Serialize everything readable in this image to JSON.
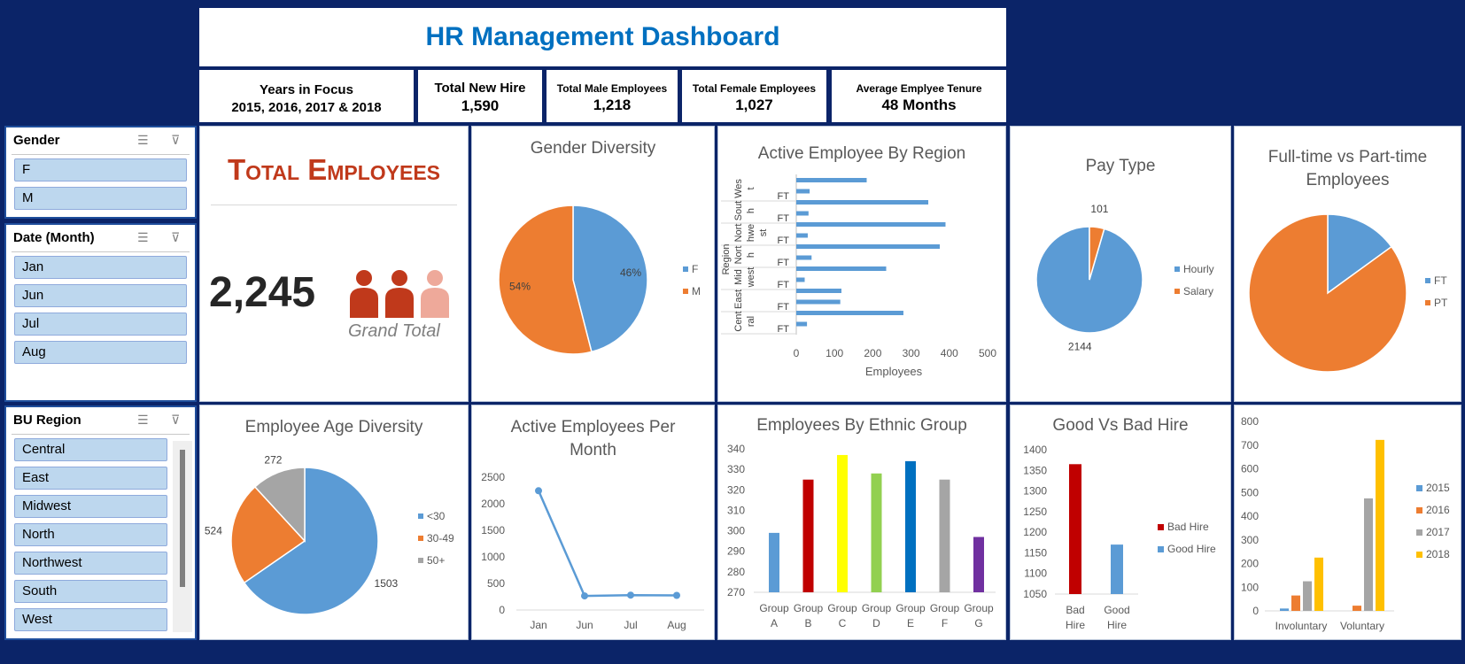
{
  "header": {
    "title": "HR Management Dashboard"
  },
  "kpis": {
    "years": {
      "label": "Years in Focus",
      "value": "2015, 2016, 2017 & 2018"
    },
    "new_hire": {
      "label": "Total New Hire",
      "value": "1,590"
    },
    "male": {
      "label": "Total Male Employees",
      "value": "1,218"
    },
    "female": {
      "label": "Total Female Employees",
      "value": "1,027"
    },
    "tenure": {
      "label": "Average Emplyee Tenure",
      "value": "48 Months"
    }
  },
  "slicers": {
    "gender": {
      "title": "Gender",
      "items": [
        "F",
        "M"
      ]
    },
    "month": {
      "title": "Date (Month)",
      "items": [
        "Jan",
        "Jun",
        "Jul",
        "Aug"
      ]
    },
    "region": {
      "title": "BU Region",
      "items": [
        "Central",
        "East",
        "Midwest",
        "North",
        "Northwest",
        "South",
        "West"
      ]
    }
  },
  "total_employees": {
    "title": "Total Employees",
    "value": "2,245",
    "caption": "Grand Total"
  },
  "colors": {
    "blue": "#5b9bd5",
    "orange": "#ed7d31",
    "gray": "#a5a5a5",
    "yellow": "#ffc000",
    "navy": "#0b2468",
    "title_blue": "#0070c0",
    "red": "#c0391b"
  },
  "chart_data": [
    {
      "id": "gender",
      "type": "pie",
      "title": "Gender Diversity",
      "labels": [
        "F",
        "M"
      ],
      "values": [
        46,
        54
      ],
      "data_labels": [
        "46%",
        "54%"
      ],
      "colors": [
        "#5b9bd5",
        "#ed7d31"
      ],
      "legend": "right"
    },
    {
      "id": "region",
      "type": "bar",
      "orientation": "horizontal",
      "title": "Active Employee By Region",
      "xlabel": "Employees",
      "ylabel": "Region",
      "xlim": [
        0,
        500
      ],
      "xticks": [
        0,
        100,
        200,
        300,
        400,
        500
      ],
      "groups": [
        "Wes t",
        "Sout h",
        "Nort hwe st",
        "Nort h",
        "Mid west",
        "East",
        "Cent ral"
      ],
      "sub_label": "FT",
      "values": [
        184,
        35,
        345,
        32,
        390,
        30,
        375,
        40,
        235,
        22,
        118,
        115,
        280,
        28
      ],
      "color": "#5b9bd5",
      "grid": false
    },
    {
      "id": "paytype",
      "type": "pie",
      "title": "Pay Type",
      "labels": [
        "Hourly",
        "Salary"
      ],
      "values": [
        2144,
        101
      ],
      "data_labels": [
        "2144",
        "101"
      ],
      "colors": [
        "#5b9bd5",
        "#ed7d31"
      ],
      "legend": "right"
    },
    {
      "id": "ftpt",
      "type": "pie",
      "title": "Full-time vs Part-time Employees",
      "labels": [
        "FT",
        "PT"
      ],
      "values": [
        15,
        85
      ],
      "colors": [
        "#5b9bd5",
        "#ed7d31"
      ],
      "legend": "right"
    },
    {
      "id": "age",
      "type": "pie",
      "title": "Employee Age Diversity",
      "labels": [
        "<30",
        "30-49",
        "50+"
      ],
      "values": [
        1503,
        524,
        272
      ],
      "data_labels": [
        "1503",
        "524",
        "272"
      ],
      "colors": [
        "#5b9bd5",
        "#ed7d31",
        "#a5a5a5"
      ],
      "legend": "right"
    },
    {
      "id": "monthly",
      "type": "line",
      "title": "Active Employees Per Month",
      "categories": [
        "Jan",
        "Jun",
        "Jul",
        "Aug"
      ],
      "values": [
        2245,
        265,
        280,
        275
      ],
      "ylim": [
        0,
        2500
      ],
      "yticks": [
        0,
        500,
        1000,
        1500,
        2000,
        2500
      ],
      "color": "#5b9bd5",
      "grid": false
    },
    {
      "id": "ethnic",
      "type": "bar",
      "title": "Employees By Ethnic Group",
      "categories": [
        "Group A",
        "Group B",
        "Group C",
        "Group D",
        "Group E",
        "Group F",
        "Group G"
      ],
      "values": [
        299,
        325,
        337,
        328,
        334,
        325,
        297
      ],
      "colors": [
        "#5b9bd5",
        "#c00000",
        "#ffff00",
        "#92d050",
        "#0070c0",
        "#a5a5a5",
        "#7030a0"
      ],
      "ylim": [
        270,
        340
      ],
      "yticks": [
        270,
        280,
        290,
        300,
        310,
        320,
        330,
        340
      ],
      "grid": false
    },
    {
      "id": "hire",
      "type": "bar",
      "title": "Good Vs Bad Hire",
      "categories": [
        "Bad Hire",
        "Good Hire"
      ],
      "values": [
        1365,
        1170
      ],
      "colors": [
        "#c00000",
        "#5b9bd5"
      ],
      "legend_labels": [
        "Bad Hire",
        "Good Hire"
      ],
      "ylim": [
        1050,
        1400
      ],
      "yticks": [
        1050,
        1100,
        1150,
        1200,
        1250,
        1300,
        1350,
        1400
      ],
      "legend": "right"
    },
    {
      "id": "turnover",
      "type": "bar",
      "categories": [
        "Involuntary",
        "Voluntary"
      ],
      "series": [
        {
          "name": "2015",
          "values": [
            10,
            0
          ],
          "color": "#5b9bd5"
        },
        {
          "name": "2016",
          "values": [
            65,
            22
          ],
          "color": "#ed7d31"
        },
        {
          "name": "2017",
          "values": [
            125,
            475
          ],
          "color": "#a5a5a5"
        },
        {
          "name": "2018",
          "values": [
            225,
            722
          ],
          "color": "#ffc000"
        }
      ],
      "ylim": [
        0,
        800
      ],
      "yticks": [
        0,
        100,
        200,
        300,
        400,
        500,
        600,
        700,
        800
      ],
      "legend": "right"
    }
  ]
}
